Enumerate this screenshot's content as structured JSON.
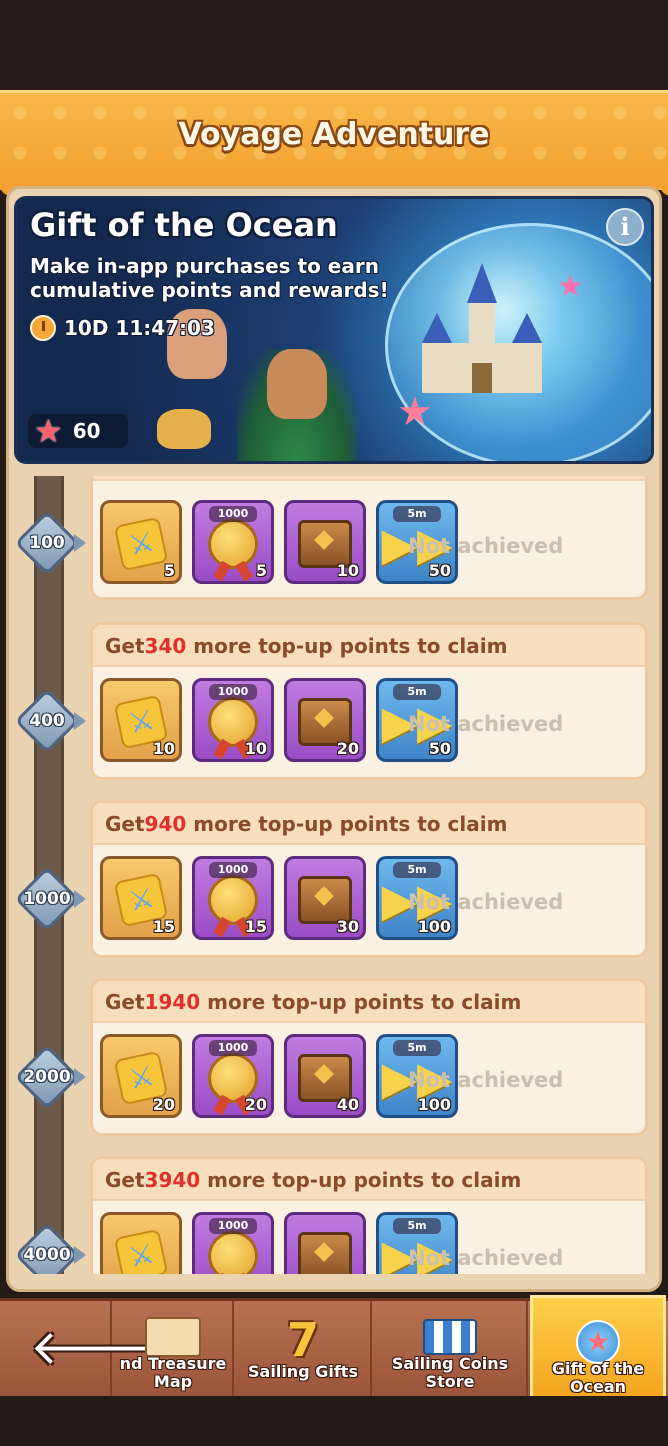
{
  "header": {
    "title": "Voyage Adventure"
  },
  "banner": {
    "title": "Gift of the Ocean",
    "description": "Make in-app purchases to earn cumulative points and rewards!",
    "timer": "10D 11:47:03",
    "points": "60",
    "info_icon": "i"
  },
  "tiers": [
    {
      "milestone": "100",
      "header_prefix": "",
      "header_number": "",
      "header_suffix": "",
      "rewards": [
        {
          "icon": "puzzle-icon",
          "tag": "",
          "qty": "5"
        },
        {
          "icon": "medal-icon",
          "tag": "1000",
          "qty": "5"
        },
        {
          "icon": "chest-icon",
          "tag": "",
          "qty": "10"
        },
        {
          "icon": "fast-forward-icon",
          "tag": "5m",
          "qty": "50"
        }
      ],
      "status": "Not achieved"
    },
    {
      "milestone": "400",
      "header_prefix": "Get",
      "header_number": "340",
      "header_suffix": " more top-up points to claim",
      "rewards": [
        {
          "icon": "puzzle-icon",
          "tag": "",
          "qty": "10"
        },
        {
          "icon": "medal-icon",
          "tag": "1000",
          "qty": "10"
        },
        {
          "icon": "chest-icon",
          "tag": "",
          "qty": "20"
        },
        {
          "icon": "fast-forward-icon",
          "tag": "5m",
          "qty": "50"
        }
      ],
      "status": "Not achieved"
    },
    {
      "milestone": "1000",
      "header_prefix": "Get",
      "header_number": "940",
      "header_suffix": " more top-up points to claim",
      "rewards": [
        {
          "icon": "puzzle-icon",
          "tag": "",
          "qty": "15"
        },
        {
          "icon": "medal-icon",
          "tag": "1000",
          "qty": "15"
        },
        {
          "icon": "chest-icon",
          "tag": "",
          "qty": "30"
        },
        {
          "icon": "fast-forward-icon",
          "tag": "5m",
          "qty": "100"
        }
      ],
      "status": "Not achieved"
    },
    {
      "milestone": "2000",
      "header_prefix": "Get",
      "header_number": "1940",
      "header_suffix": " more top-up points to claim",
      "rewards": [
        {
          "icon": "puzzle-icon",
          "tag": "",
          "qty": "20"
        },
        {
          "icon": "medal-icon",
          "tag": "1000",
          "qty": "20"
        },
        {
          "icon": "chest-icon",
          "tag": "",
          "qty": "40"
        },
        {
          "icon": "fast-forward-icon",
          "tag": "5m",
          "qty": "100"
        }
      ],
      "status": "Not achieved"
    },
    {
      "milestone": "4000",
      "header_prefix": "Get",
      "header_number": "3940",
      "header_suffix": " more top-up points to claim",
      "rewards": [
        {
          "icon": "puzzle-icon",
          "tag": "",
          "qty": ""
        },
        {
          "icon": "medal-icon",
          "tag": "1000",
          "qty": ""
        },
        {
          "icon": "chest-icon",
          "tag": "",
          "qty": ""
        },
        {
          "icon": "fast-forward-icon",
          "tag": "5m",
          "qty": ""
        }
      ],
      "status": "Not achieved"
    }
  ],
  "nav": {
    "back_icon": "back-arrow-icon",
    "items": [
      {
        "label_line1": "nd Treasure",
        "label_line2": "Map",
        "icon": "treasure-map-icon"
      },
      {
        "label_line1": "Sailing Gifts",
        "label_line2": "",
        "icon": "seven-gift-icon"
      },
      {
        "label_line1": "Sailing Coins",
        "label_line2": "Store",
        "icon": "shop-icon"
      },
      {
        "label_line1": "Gift of the",
        "label_line2": "Ocean",
        "icon": "ocean-star-icon"
      }
    ]
  },
  "colors": {
    "accent": "#f2a02e",
    "highlight_number": "#e0302a",
    "status_text": "#cbbfae"
  }
}
